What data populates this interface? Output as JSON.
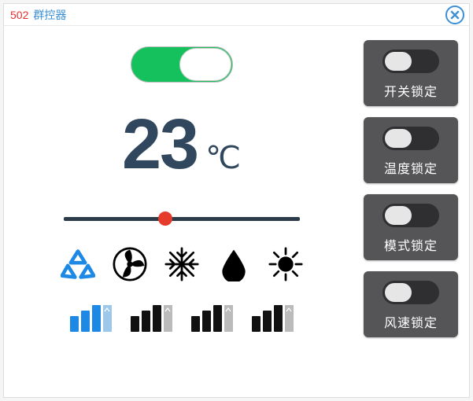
{
  "title": {
    "code": "502",
    "name": "群控器"
  },
  "power": {
    "on": true
  },
  "temperature": {
    "value": "23",
    "unit": "℃",
    "slider_pct": 43
  },
  "modes": {
    "items": [
      {
        "key": "auto",
        "icon": "recycle-icon",
        "active": true
      },
      {
        "key": "fan",
        "icon": "fan-icon",
        "active": false
      },
      {
        "key": "cool",
        "icon": "snowflake-icon",
        "active": false
      },
      {
        "key": "dry",
        "icon": "droplet-icon",
        "active": false
      },
      {
        "key": "heat",
        "icon": "sun-icon",
        "active": false
      }
    ]
  },
  "fan_speed": {
    "levels": [
      {
        "key": "low",
        "active": true
      },
      {
        "key": "mid",
        "active": false
      },
      {
        "key": "high",
        "active": false
      },
      {
        "key": "auto",
        "active": false
      }
    ]
  },
  "locks": {
    "items": [
      {
        "key": "power_lock",
        "label": "开关锁定",
        "on": false
      },
      {
        "key": "temp_lock",
        "label": "温度锁定",
        "on": false
      },
      {
        "key": "mode_lock",
        "label": "模式锁定",
        "on": false
      },
      {
        "key": "fan_lock",
        "label": "风速锁定",
        "on": false
      }
    ]
  }
}
